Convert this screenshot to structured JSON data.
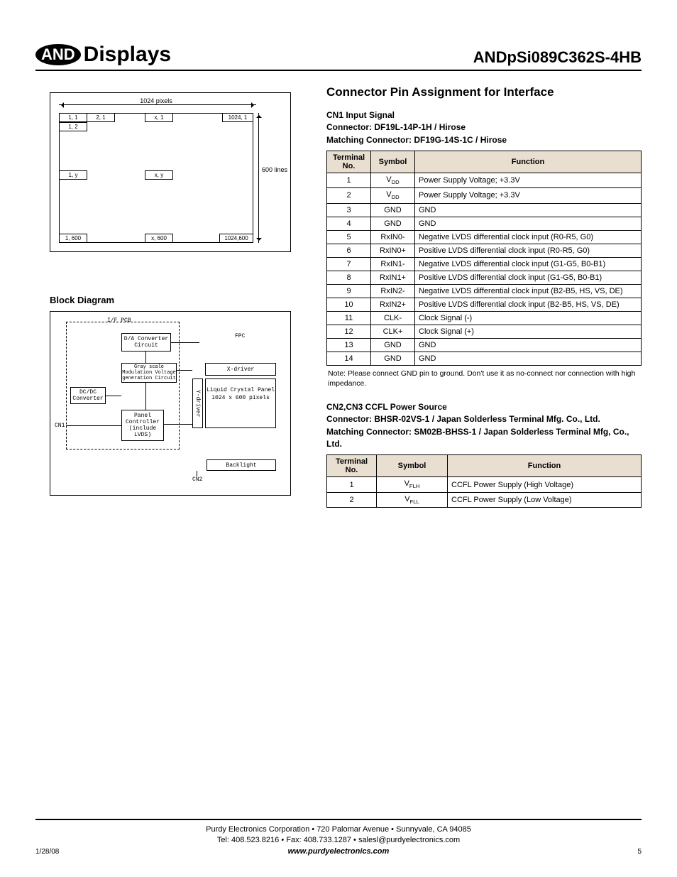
{
  "header": {
    "logo_badge": "AND",
    "logo_text": "Displays",
    "part_number": "ANDpSi089C362S-4HB"
  },
  "pixel_diagram": {
    "top_label": "1024 pixels",
    "right_label": "600 lines",
    "cells": {
      "c11": "1, 1",
      "c21": "2, 1",
      "cx1": "x, 1",
      "cw1": "1024, 1",
      "c12": "1, 2",
      "c1y": "1, y",
      "cxy": "x, y",
      "c1h": "1, 600",
      "cxh": "x, 600",
      "cwh": "1024,600"
    }
  },
  "block_diagram": {
    "title": "Block Diagram",
    "labels": {
      "ifpcb": "I/F PCB",
      "da": "D/A Converter Circuit",
      "fpc": "FPC",
      "xdrv": "X-driver",
      "gray": "Gray scale Modulation Voltage generation Circuit",
      "dcdc": "DC/DC Converter",
      "lcp1": "Liquid Crystal Panel",
      "lcp2": "1024 x 600 pixels",
      "panel": "Panel Controller (include LVDS)",
      "ydrv": "Y-driver",
      "backlight": "Backlight",
      "cn1": "CN1",
      "cn2": "CN2"
    }
  },
  "right": {
    "section_title": "Connector Pin Assignment for Interface",
    "cn1": {
      "t1": "CN1 Input Signal",
      "t2": "Connector: DF19L-14P-1H / Hirose",
      "t3": "Matching Connector: DF19G-14S-1C / Hirose",
      "headers": {
        "a": "Terminal No.",
        "b": "Symbol",
        "c": "Function"
      },
      "rows": [
        {
          "n": "1",
          "s": "V",
          "sub": "DD",
          "f": "Power Supply Voltage; +3.3V"
        },
        {
          "n": "2",
          "s": "V",
          "sub": "DD",
          "f": "Power Supply Voltage; +3.3V"
        },
        {
          "n": "3",
          "s": "GND",
          "f": "GND"
        },
        {
          "n": "4",
          "s": "GND",
          "f": "GND"
        },
        {
          "n": "5",
          "s": "RxIN0-",
          "f": "Negative LVDS differential clock input (R0-R5, G0)"
        },
        {
          "n": "6",
          "s": "RxIN0+",
          "f": "Positive LVDS differential clock input (R0-R5, G0)"
        },
        {
          "n": "7",
          "s": "RxIN1-",
          "f": "Negative LVDS differential clock input (G1-G5, B0-B1)"
        },
        {
          "n": "8",
          "s": "RxIN1+",
          "f": "Positive LVDS differential clock input (G1-G5, B0-B1)"
        },
        {
          "n": "9",
          "s": "RxIN2-",
          "f": "Negative LVDS differential clock input (B2-B5, HS, VS, DE)"
        },
        {
          "n": "10",
          "s": "RxIN2+",
          "f": "Positive LVDS differential clock input (B2-B5, HS, VS, DE)"
        },
        {
          "n": "11",
          "s": "CLK-",
          "f": "Clock Signal (-)"
        },
        {
          "n": "12",
          "s": "CLK+",
          "f": "Clock Signal (+)"
        },
        {
          "n": "13",
          "s": "GND",
          "f": "GND"
        },
        {
          "n": "14",
          "s": "GND",
          "f": "GND"
        }
      ],
      "note": "Note: Please connect GND pin to ground. Don't use it as no-connect nor connection with high impedance."
    },
    "cn23": {
      "t1": "CN2,CN3 CCFL Power Source",
      "t2": "Connector: BHSR-02VS-1 / Japan Solderless Terminal Mfg. Co., Ltd.",
      "t3": "Matching Connector: SM02B-BHSS-1 / Japan Solderless Terminal Mfg, Co., Ltd.",
      "headers": {
        "a": "Terminal No.",
        "b": "Symbol",
        "c": "Function"
      },
      "rows": [
        {
          "n": "1",
          "s": "V",
          "sub": "FLH",
          "f": "CCFL Power Supply (High Voltage)"
        },
        {
          "n": "2",
          "s": "V",
          "sub": "FLL",
          "f": "CCFL Power Supply (Low Voltage)"
        }
      ]
    }
  },
  "footer": {
    "line1": "Purdy Electronics Corporation  •  720 Palomar Avenue  •  Sunnyvale, CA 94085",
    "line2": "Tel: 408.523.8216  •  Fax: 408.733.1287  •  salesl@purdyelectronics.com",
    "url": "www.purdyelectronics.com",
    "date": "1/28/08",
    "page": "5"
  }
}
